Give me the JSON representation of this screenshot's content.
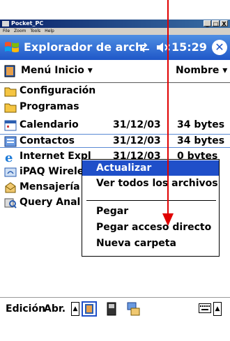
{
  "host_window": {
    "title": "Pocket_PC",
    "controls": [
      "_",
      "□",
      "X"
    ],
    "menu": [
      "File",
      "Zoom",
      "Tools",
      "Help"
    ]
  },
  "nav_bar": {
    "title": "Explorador de arch",
    "time": "15:29",
    "close_label": "✕",
    "colors": {
      "bar": "#1f57c8",
      "bar_top": "#4f8fe3"
    }
  },
  "header": {
    "folder_menu": "Menú Inicio ▾",
    "sort_menu": "Nombre ▾"
  },
  "files": [
    {
      "name": "Configuración",
      "date": "",
      "size": "",
      "icon": "folder-icon"
    },
    {
      "name": "Programas",
      "date": "",
      "size": "",
      "icon": "folder-icon"
    },
    {
      "name": "Calendario",
      "date": "31/12/03",
      "size": "34 bytes",
      "icon": "calendar-icon"
    },
    {
      "name": "Contactos",
      "date": "31/12/03",
      "size": "34 bytes",
      "icon": "contacts-icon"
    },
    {
      "name": "Internet Expl",
      "date": "31/12/03",
      "size": "0 bytes",
      "icon": "internet-explorer-icon"
    },
    {
      "name": "iPAQ Wirele",
      "date": "",
      "size": "",
      "icon": "ipaq-wireless-icon"
    },
    {
      "name": "Mensajería",
      "date": "",
      "size": "",
      "icon": "messaging-icon"
    },
    {
      "name": "Query Anal",
      "date": "",
      "size": "",
      "icon": "query-analyzer-icon"
    }
  ],
  "context_menu": {
    "items": [
      {
        "label": "Actualizar",
        "active": true
      },
      {
        "label": "Ver todos los archivos",
        "active": false
      },
      {
        "label": "Pegar",
        "active": false
      },
      {
        "label": "Pegar acceso directo",
        "active": false
      },
      {
        "label": "Nueva carpeta",
        "active": false
      }
    ],
    "highlight_color": "#1f4fc9"
  },
  "command_bar": {
    "edit": "Edición",
    "open": "Abr.",
    "up_arrow": "▲",
    "keyboard_up": "▲"
  },
  "annotation": {
    "arrow_color": "#e00000"
  }
}
